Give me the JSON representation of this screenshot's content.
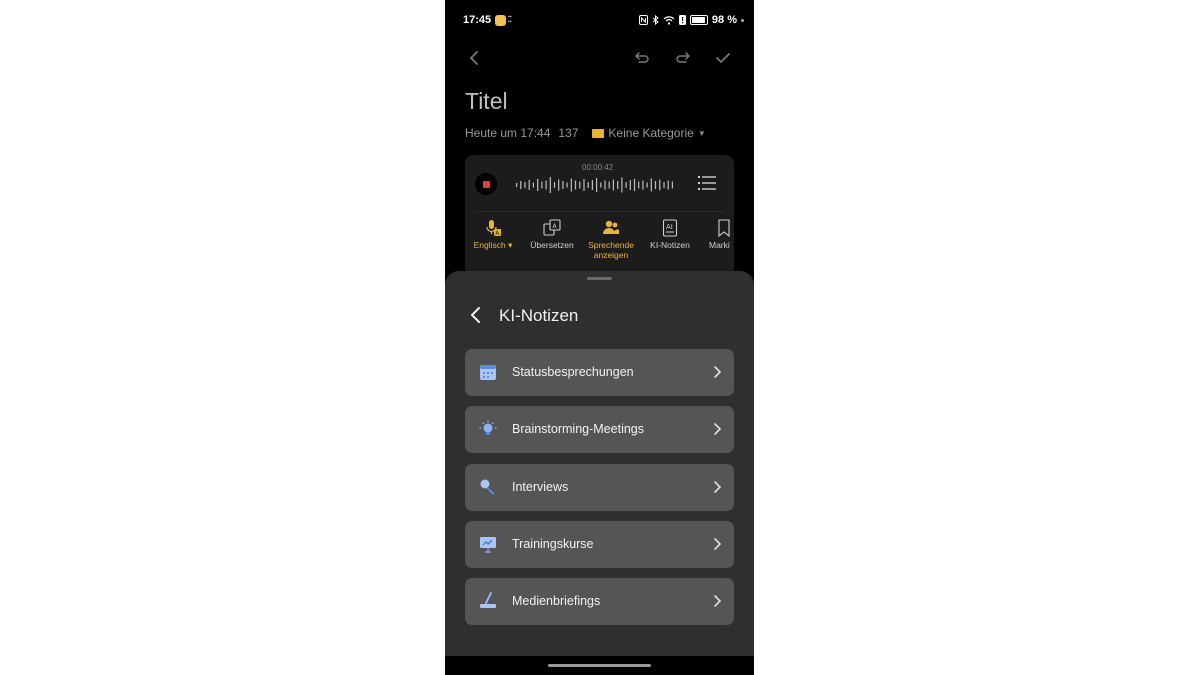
{
  "status_bar": {
    "time": "17:45",
    "battery": "98 %"
  },
  "note": {
    "title": "Titel",
    "date": "Heute um 17:44",
    "char_count": "137",
    "category": "Keine Kategorie"
  },
  "recorder": {
    "elapsed": "00:00:42",
    "tools": [
      {
        "label": "Englisch"
      },
      {
        "label": "Übersetzen"
      },
      {
        "label_line1": "Sprechende",
        "label_line2": "anzeigen"
      },
      {
        "label": "KI-Notizen"
      },
      {
        "label": "Marki"
      }
    ]
  },
  "sheet": {
    "title": "KI-Notizen",
    "items": [
      {
        "label": "Statusbesprechungen",
        "icon": "calendar-icon"
      },
      {
        "label": "Brainstorming-Meetings",
        "icon": "lightbulb-icon"
      },
      {
        "label": "Interviews",
        "icon": "microphone-icon"
      },
      {
        "label": "Trainingskurse",
        "icon": "presentation-icon"
      },
      {
        "label": "Medienbriefings",
        "icon": "broadcast-icon"
      }
    ]
  },
  "colors": {
    "accent": "#e8b33a",
    "record": "#e04040",
    "sheet_bg": "#2f2f2f",
    "item_bg": "#555555"
  }
}
